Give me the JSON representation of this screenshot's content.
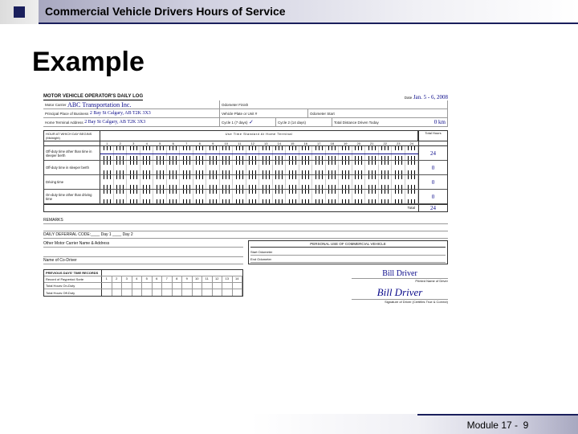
{
  "header": {
    "title": "Commercial Vehicle Drivers Hours of Service"
  },
  "slide": {
    "title": "Example"
  },
  "form": {
    "title": "MOTOR VEHICLE OPERATOR'S DAILY LOG",
    "date_lbl": "Date",
    "date_val": "Jan. 5 - 6, 2008",
    "carrier_lbl": "Motor Carrier",
    "carrier_val": "ABC Transportation Inc.",
    "odo_lbl": "Odometer Finish",
    "principal_lbl": "Principal Place of Business",
    "principal_val": "2 Bay St Calgary, AB T2K 3X3",
    "plate_lbl": "Vehicle Plate or Unit #",
    "odo_start_lbl": "Odometer Start",
    "terminal_lbl": "Home Terminal Address",
    "terminal_val": "2 Bay St Calgary, AB T2K 3X3",
    "cycle1_lbl": "Cycle 1 (7 days)",
    "cycle1_val": "✓",
    "cycle2_lbl": "Cycle 2 (14 days)",
    "dist_lbl": "Total Distance Driven Today",
    "dist_val": "0 km",
    "grid_head_left": "HOUR AT WHICH DAY BEGINS (Midnight)",
    "grid_head_mid": "Use Time Standard At Home Terminal",
    "total_hours_lbl": "Total Hours",
    "hours": [
      "1",
      "2",
      "3",
      "4",
      "5",
      "6",
      "7",
      "8",
      "9",
      "10",
      "11",
      "12",
      "13",
      "14",
      "15",
      "16",
      "17",
      "18",
      "19",
      "20",
      "21",
      "22",
      "23",
      "24"
    ],
    "duty_rows": [
      {
        "label": "Off-duty time other than time in sleeper berth",
        "total": "24",
        "line": true
      },
      {
        "label": "Off-duty time in sleeper berth",
        "total": "0",
        "line": false
      },
      {
        "label": "Driving time",
        "total": "0",
        "line": false
      },
      {
        "label": "On-duty time other than driving time",
        "total": "0",
        "line": false
      }
    ],
    "grand_total_lbl": "Total",
    "grand_total": "24",
    "remarks_lbl": "REMARKS",
    "deferral_lbl": "DAILY DEFERRAL CODE:____ Day 1 ____ Day 2",
    "other_carrier_lbl": "Other Motor Carrier Name & Address",
    "personal_title": "PERSONAL USE OF COMMERCIAL VEHICLE",
    "pers_start": "Start Odometer",
    "pers_end": "End Odometer",
    "codriver_lbl": "Name of Co-Driver",
    "printed_name_lbl": "Printed Name of Driver",
    "printed_name_val": "Bill Driver",
    "sig_lbl": "Signature of Driver (Certifies True & Correct)",
    "sig_val": "Bill Driver",
    "prev_title": "PREVIOUS DAYS' TIME RECORDS",
    "prev_days_lbl": "Record of Payperiod Sorte",
    "prev_days": [
      "1",
      "2",
      "3",
      "4",
      "5",
      "6",
      "7",
      "8",
      "9",
      "10",
      "11",
      "12",
      "13",
      "14"
    ],
    "prev_on_lbl": "Total Hours On-Duty",
    "prev_off_lbl": "Total Hours Off-Duty"
  },
  "footer": {
    "module": "Module 17 -",
    "page": "9"
  }
}
